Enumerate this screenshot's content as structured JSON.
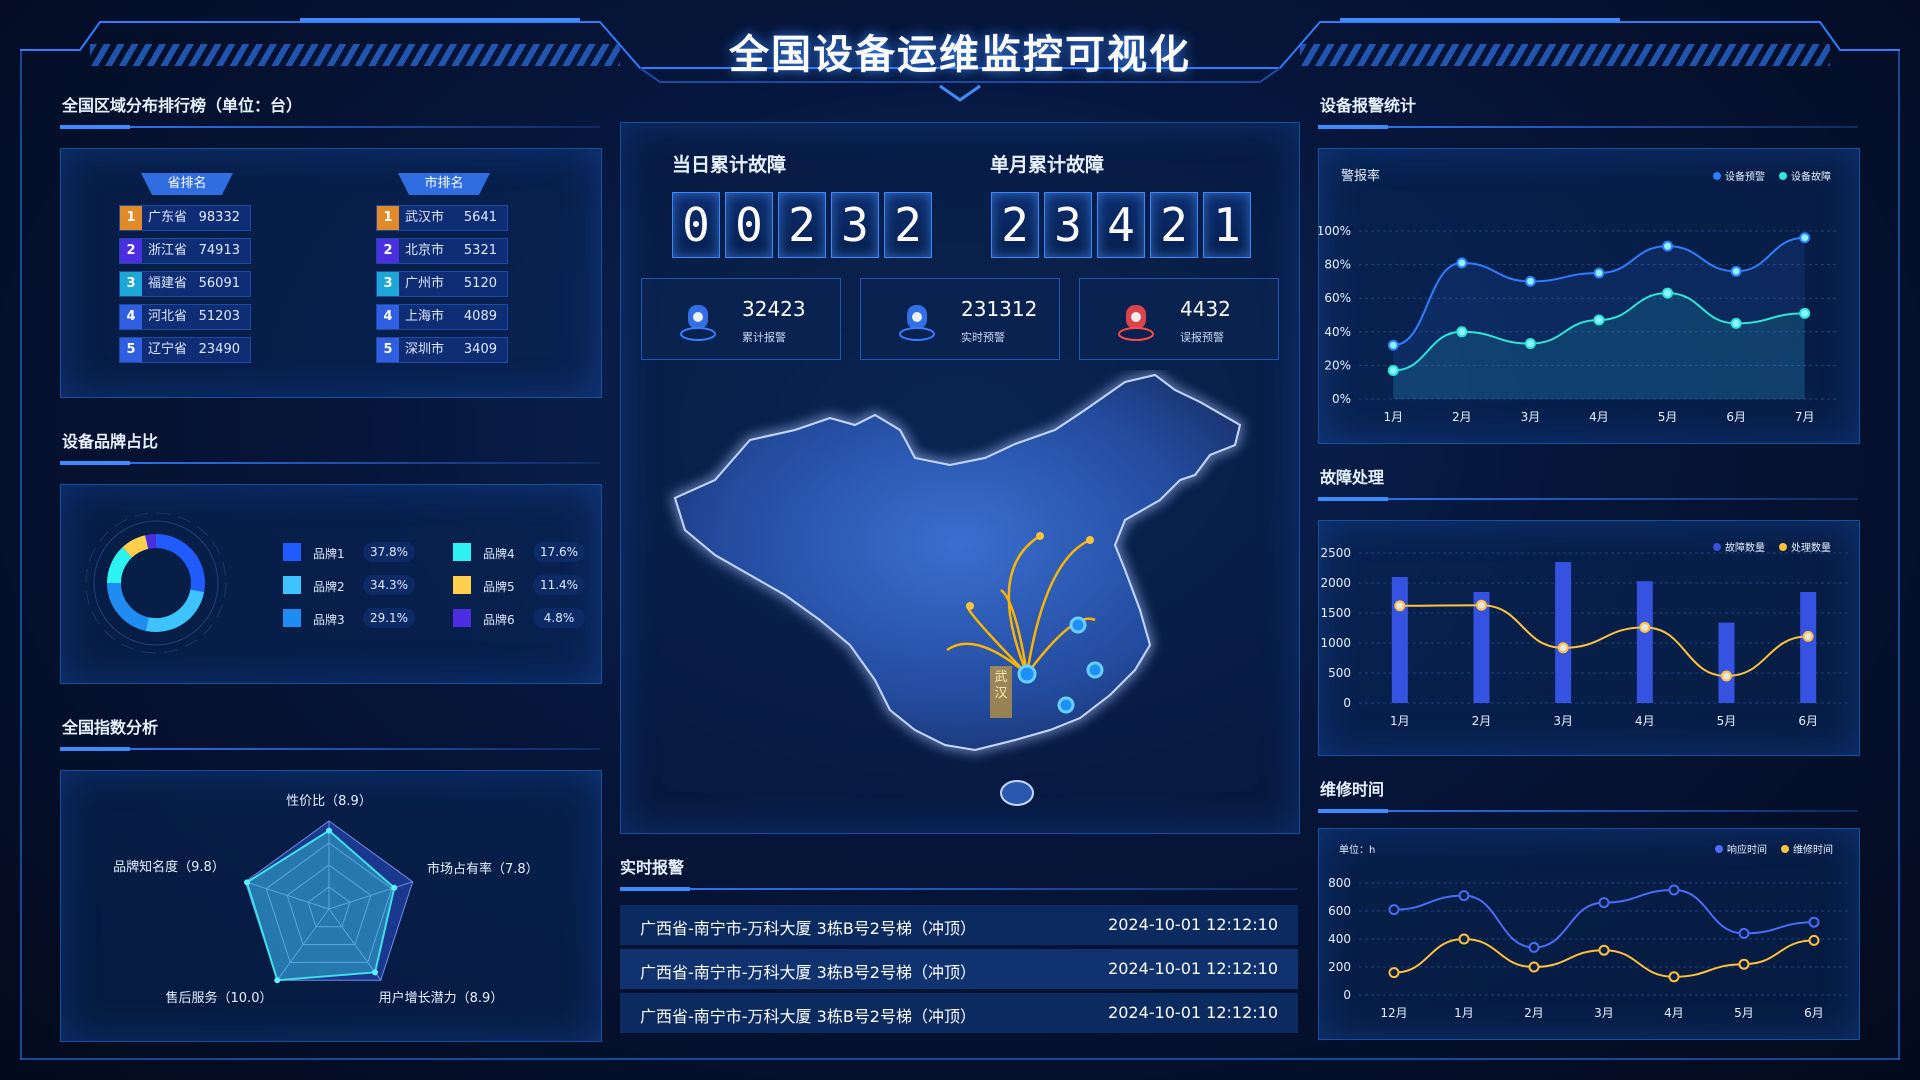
{
  "title": "全国设备运维监控可视化",
  "colors": {
    "accent": "#2f7cff",
    "cyan": "#2ee6d6",
    "yellow": "#ffc23a",
    "bar": "#3552e0"
  },
  "left": {
    "ranking": {
      "title": "全国区域分布排行榜（单位：台）",
      "province_header": "省排名",
      "city_header": "市排名",
      "provinces": [
        {
          "rank": "1",
          "name": "广东省",
          "value": "98332"
        },
        {
          "rank": "2",
          "name": "浙江省",
          "value": "74913"
        },
        {
          "rank": "3",
          "name": "福建省",
          "value": "56091"
        },
        {
          "rank": "4",
          "name": "河北省",
          "value": "51203"
        },
        {
          "rank": "5",
          "name": "辽宁省",
          "value": "23490"
        }
      ],
      "cities": [
        {
          "rank": "1",
          "name": "武汉市",
          "value": "5641"
        },
        {
          "rank": "2",
          "name": "北京市",
          "value": "5321"
        },
        {
          "rank": "3",
          "name": "广州市",
          "value": "5120"
        },
        {
          "rank": "4",
          "name": "上海市",
          "value": "4089"
        },
        {
          "rank": "5",
          "name": "深圳市",
          "value": "3409"
        }
      ]
    },
    "brand": {
      "title": "设备品牌占比",
      "items": [
        {
          "name": "品牌1",
          "pct": "37.8%",
          "color": "#1f5bff"
        },
        {
          "name": "品牌2",
          "pct": "34.3%",
          "color": "#3fc3ff"
        },
        {
          "name": "品牌3",
          "pct": "29.1%",
          "color": "#1e8cf0"
        },
        {
          "name": "品牌4",
          "pct": "17.6%",
          "color": "#2ef2f2"
        },
        {
          "name": "品牌5",
          "pct": "11.4%",
          "color": "#ffcf4d"
        },
        {
          "name": "品牌6",
          "pct": "4.8%",
          "color": "#4a2ee0"
        }
      ]
    },
    "index": {
      "title": "全国指数分析",
      "labels": [
        "性价比（8.9）",
        "市场占有率（7.8）",
        "用户增长潜力（8.9）",
        "售后服务（10.0）",
        "品牌知名度（9.8）"
      ]
    }
  },
  "center": {
    "daily_title": "当日累计故障",
    "daily_digits": [
      "0",
      "0",
      "2",
      "3",
      "2"
    ],
    "monthly_title": "单月累计故障",
    "monthly_digits": [
      "2",
      "3",
      "4",
      "2",
      "1"
    ],
    "stats": [
      {
        "value": "32423",
        "label": "累计报警",
        "icon": "alarm-bell-icon"
      },
      {
        "value": "231312",
        "label": "实时预警",
        "icon": "check-shield-icon"
      },
      {
        "value": "4432",
        "label": "误报预警",
        "icon": "warning-light-icon"
      }
    ],
    "map_city_label": "武汉",
    "alerts_title": "实时报警",
    "alerts": [
      {
        "text": "广西省-南宁市-万科大厦 3栋B号2号梯（冲顶）",
        "time": "2024-10-01 12:12:10"
      },
      {
        "text": "广西省-南宁市-万科大厦 3栋B号2号梯（冲顶）",
        "time": "2024-10-01 12:12:10"
      },
      {
        "text": "广西省-南宁市-万科大厦 3栋B号2号梯（冲顶）",
        "time": "2024-10-01 12:12:10"
      }
    ]
  },
  "right": {
    "alarm_title": "设备报警统计",
    "fault_title": "故障处理",
    "repair_title": "维修时间"
  },
  "chart_data": [
    {
      "type": "line",
      "ylabel": "警报率",
      "categories": [
        "1月",
        "2月",
        "3月",
        "4月",
        "5月",
        "6月",
        "7月"
      ],
      "y_ticks": [
        "100%",
        "80%",
        "60%",
        "40%",
        "20%",
        "0%"
      ],
      "ylim": [
        0,
        100
      ],
      "legend": "top-right",
      "series": [
        {
          "name": "设备预警",
          "values": [
            32,
            81,
            70,
            75,
            91,
            76,
            96
          ]
        },
        {
          "name": "设备故障",
          "values": [
            17,
            40,
            33,
            47,
            63,
            45,
            51
          ]
        }
      ]
    },
    {
      "type": "bar",
      "categories": [
        "1月",
        "2月",
        "3月",
        "4月",
        "5月",
        "6月"
      ],
      "y_ticks": [
        "2500",
        "2000",
        "1500",
        "1000",
        "500",
        "0"
      ],
      "ylim": [
        0,
        2500
      ],
      "legend": "top-right",
      "series": [
        {
          "name": "故障数量",
          "values": [
            2100,
            1850,
            2350,
            2030,
            1340,
            1850
          ]
        },
        {
          "name": "处理数量",
          "values": [
            1620,
            1630,
            920,
            1260,
            450,
            1110
          ]
        }
      ]
    },
    {
      "type": "line",
      "ylabel": "单位：h",
      "categories": [
        "12月",
        "1月",
        "2月",
        "3月",
        "4月",
        "5月",
        "6月"
      ],
      "y_ticks": [
        "800",
        "600",
        "400",
        "200",
        "0"
      ],
      "ylim": [
        0,
        800
      ],
      "legend": "top-right",
      "series": [
        {
          "name": "响应时间",
          "values": [
            610,
            710,
            340,
            660,
            750,
            440,
            520
          ]
        },
        {
          "name": "维修时间",
          "values": [
            160,
            400,
            200,
            320,
            130,
            220,
            390
          ]
        }
      ]
    },
    {
      "type": "pie",
      "categories": [
        "品牌1",
        "品牌2",
        "品牌3",
        "品牌4",
        "品牌5",
        "品牌6"
      ],
      "values": [
        37.8,
        34.3,
        29.1,
        17.6,
        11.4,
        4.8
      ]
    },
    {
      "type": "radar",
      "categories": [
        "性价比",
        "市场占有率",
        "用户增长潜力",
        "售后服务",
        "品牌知名度"
      ],
      "values": [
        8.9,
        7.8,
        8.9,
        10.0,
        9.8
      ],
      "ylim": [
        0,
        10
      ]
    }
  ]
}
